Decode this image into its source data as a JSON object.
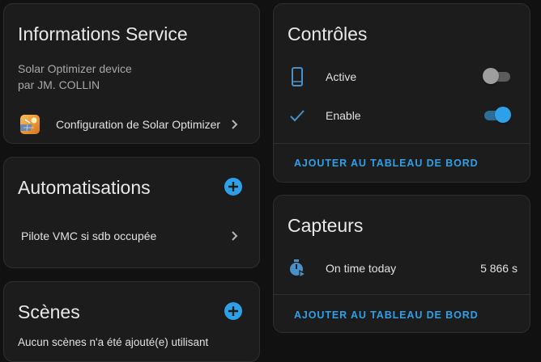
{
  "info_card": {
    "title": "Informations Service",
    "device_line": "Solar Optimizer device",
    "author_line": "par JM. COLLIN",
    "config_link": "Configuration de Solar Optimizer",
    "config_icon": "solar-optimizer-logo-icon"
  },
  "automations_card": {
    "title": "Automatisations",
    "add_icon": "plus-circle-icon",
    "items": [
      {
        "label": "Pilote VMC si sdb occupée"
      }
    ]
  },
  "scenes_card": {
    "title": "Scènes",
    "add_icon": "plus-circle-icon",
    "empty_text": "Aucun scènes n'a été ajouté(e) utilisant"
  },
  "controls_card": {
    "title": "Contrôles",
    "rows": [
      {
        "icon": "cellphone-icon",
        "label": "Active",
        "state": "off"
      },
      {
        "icon": "check-icon",
        "label": "Enable",
        "state": "on"
      }
    ],
    "action": "AJOUTER AU TABLEAU DE BORD"
  },
  "sensors_card": {
    "title": "Capteurs",
    "rows": [
      {
        "icon": "timer-play-icon",
        "label": "On time today",
        "value": "5 866 s"
      }
    ],
    "action": "AJOUTER AU TABLEAU DE BORD"
  },
  "colors": {
    "background": "#111111",
    "card": "#1c1c1c",
    "accent": "#2ea0e8",
    "icon": "#4a90c8"
  }
}
